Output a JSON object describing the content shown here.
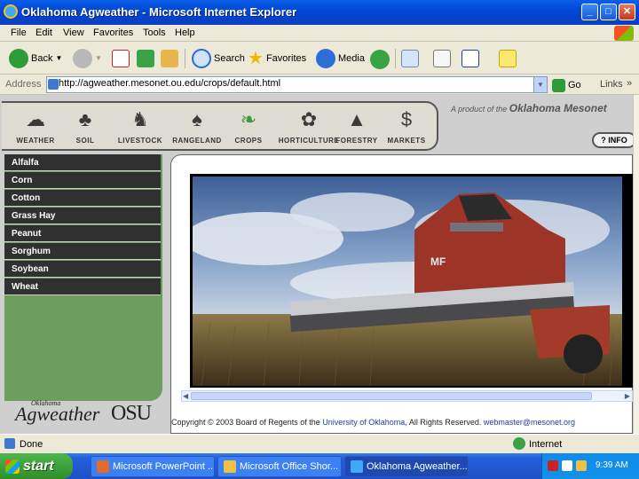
{
  "window": {
    "title": "Oklahoma Agweather - Microsoft Internet Explorer"
  },
  "menu": [
    "File",
    "Edit",
    "View",
    "Favorites",
    "Tools",
    "Help"
  ],
  "toolbar": {
    "back": "Back",
    "search": "Search",
    "favorites": "Favorites",
    "media": "Media"
  },
  "address": {
    "label": "Address",
    "url": "http://agweather.mesonet.ou.edu/crops/default.html",
    "go": "Go",
    "links": "Links"
  },
  "site": {
    "nav": [
      {
        "label": "WEATHER",
        "icon": "cloud-icon"
      },
      {
        "label": "SOIL",
        "icon": "sprout-icon"
      },
      {
        "label": "LIVESTOCK",
        "icon": "cow-icon"
      },
      {
        "label": "RANGELAND",
        "icon": "tree-icon"
      },
      {
        "label": "CROPS",
        "icon": "leaf-icon"
      },
      {
        "label": "HORTICULTURE",
        "icon": "flower-icon"
      },
      {
        "label": "FORESTRY",
        "icon": "pine-icon"
      },
      {
        "label": "MARKETS",
        "icon": "dollar-icon"
      }
    ],
    "tagline_prefix": "A product of the",
    "tagline_brand": "Oklahoma Mesonet",
    "info": "? INFO",
    "crops": [
      "Alfalfa",
      "Corn",
      "Cotton",
      "Grass Hay",
      "Peanut",
      "Sorghum",
      "Soybean",
      "Wheat"
    ],
    "logo_agweather": "Agweather",
    "logo_oklahoma": "Oklahoma",
    "logo_osu": "OSU",
    "copyright_text": "Copyright © 2003 Board of Regents of the",
    "copyright_univ": "University of Oklahoma",
    "copyright_rights": ", All Rights Reserved.",
    "copyright_email": "webmaster@mesonet.org"
  },
  "status": {
    "text": "Done",
    "zone": "Internet"
  },
  "taskbar": {
    "start": "start",
    "tasks": [
      "Microsoft PowerPoint ...",
      "Microsoft Office Shor...",
      "Oklahoma Agweather..."
    ],
    "clock": "9:39 AM"
  },
  "colors": {
    "xp_blue": "#0046d5",
    "menu_green": "#6e9e5f",
    "crop_dark": "#303030"
  }
}
